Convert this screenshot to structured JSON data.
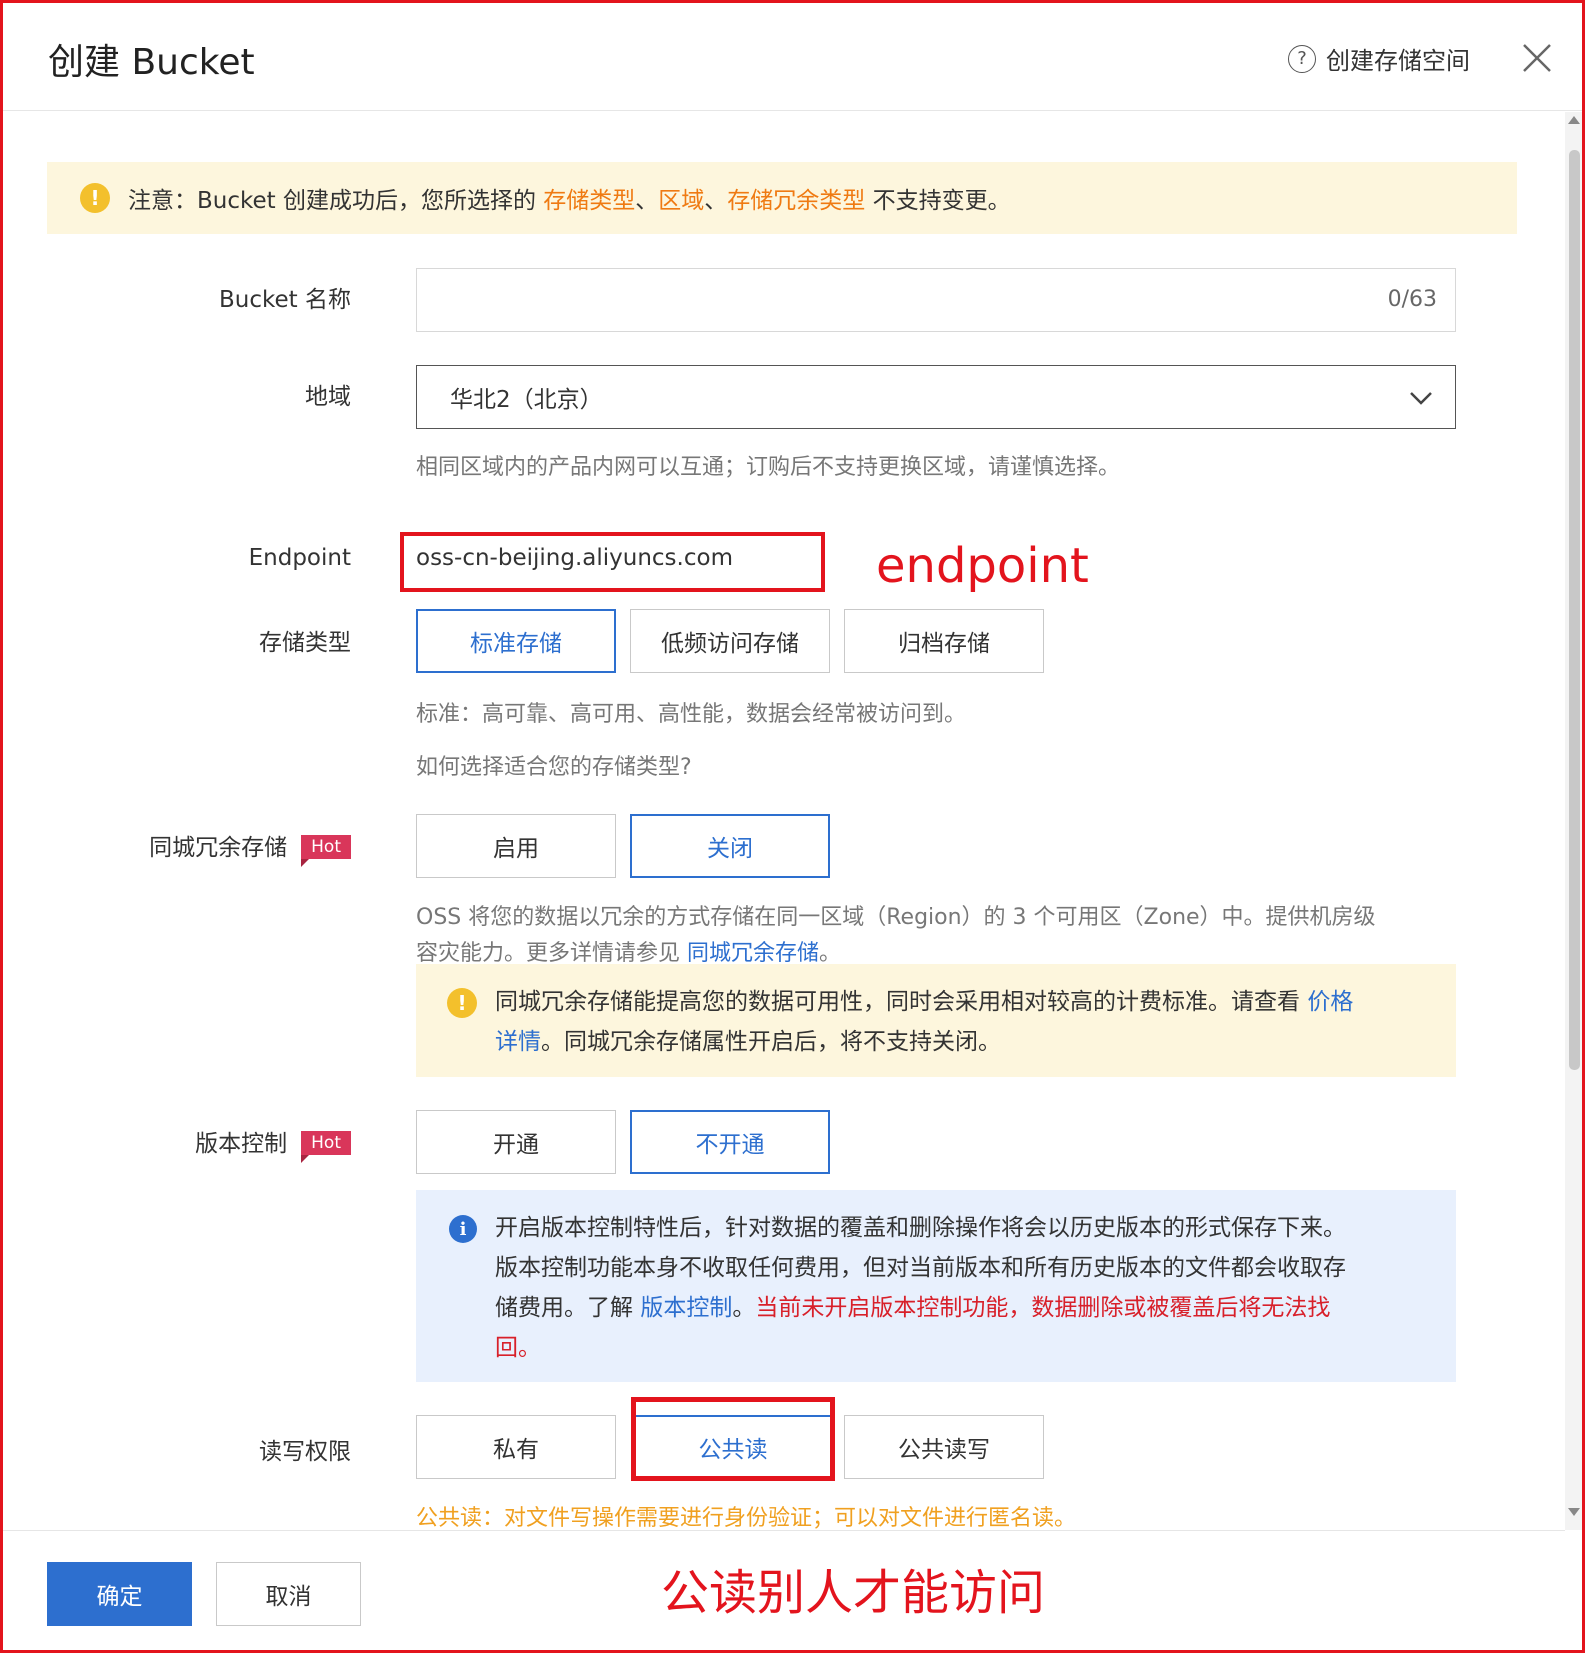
{
  "header": {
    "title": "创建 Bucket",
    "help_label": "创建存储空间"
  },
  "notice": {
    "prefix": "注意：Bucket 创建成功后，您所选择的 ",
    "highlight1": "存储类型",
    "sep1": "、",
    "highlight2": "区域",
    "sep2": "、",
    "highlight3": "存储冗余类型",
    "suffix": " 不支持变更。"
  },
  "bucket_name": {
    "label": "Bucket 名称",
    "value": "",
    "counter": "0/63"
  },
  "region": {
    "label": "地域",
    "value": "华北2（北京）",
    "help": "相同区域内的产品内网可以互通；订购后不支持更换区域，请谨慎选择。"
  },
  "endpoint": {
    "label": "Endpoint",
    "value": "oss-cn-beijing.aliyuncs.com",
    "annotation": "endpoint"
  },
  "storage_type": {
    "label": "存储类型",
    "options": [
      "标准存储",
      "低频访问存储",
      "归档存储"
    ],
    "selected": "标准存储",
    "help": "标准：高可靠、高可用、高性能，数据会经常被访问到。",
    "link": "如何选择适合您的存储类型?"
  },
  "zrs": {
    "label": "同城冗余存储",
    "badge": "Hot",
    "options": [
      "启用",
      "关闭"
    ],
    "selected": "关闭",
    "help_line1": "OSS 将您的数据以冗余的方式存储在同一区域（Region）的 3 个可用区（Zone）中。提供机房级",
    "help_line2_prefix": "容灾能力。更多详情请参见 ",
    "help_link": "同城冗余存储",
    "help_line2_suffix": "。",
    "tip_line1_prefix": "同城冗余存储能提高您的数据可用性，同时会采用相对较高的计费标准。请查看 ",
    "tip_link_part1": "价格",
    "tip_link_part2": "详情",
    "tip_line2_suffix": "。同城冗余存储属性开启后，将不支持关闭。"
  },
  "versioning": {
    "label": "版本控制",
    "badge": "Hot",
    "options": [
      "开通",
      "不开通"
    ],
    "selected": "不开通",
    "info_line1": "开启版本控制特性后，针对数据的覆盖和删除操作将会以历史版本的形式保存下来。",
    "info_line2": "版本控制功能本身不收取任何费用，但对当前版本和所有历史版本的文件都会收取存",
    "info_line3_prefix": "储费用。了解 ",
    "info_link": "版本控制",
    "info_line3_mid": "。",
    "info_warn_part1": "当前未开启版本控制功能，数据删除或被覆盖后将无法找",
    "info_warn_part2": "回。"
  },
  "acl": {
    "label": "读写权限",
    "options": [
      "私有",
      "公共读",
      "公共读写"
    ],
    "selected": "公共读",
    "help": "公共读：对文件写操作需要进行身份验证；可以对文件进行匿名读。",
    "annotation": "公读别人才能访问"
  },
  "footer": {
    "confirm": "确定",
    "cancel": "取消"
  },
  "colors": {
    "primary": "#2d6fcf",
    "annotation_red": "#e3141d",
    "warning_orange": "#ef7a12",
    "hot_badge": "#d9365a",
    "notice_bg": "#fdf6dd",
    "info_bg": "#e8f0fd"
  },
  "icons": [
    "question-circle-icon",
    "close-icon",
    "warning-icon",
    "chevron-down-icon",
    "info-icon",
    "scroll-up-icon",
    "scroll-down-icon"
  ]
}
